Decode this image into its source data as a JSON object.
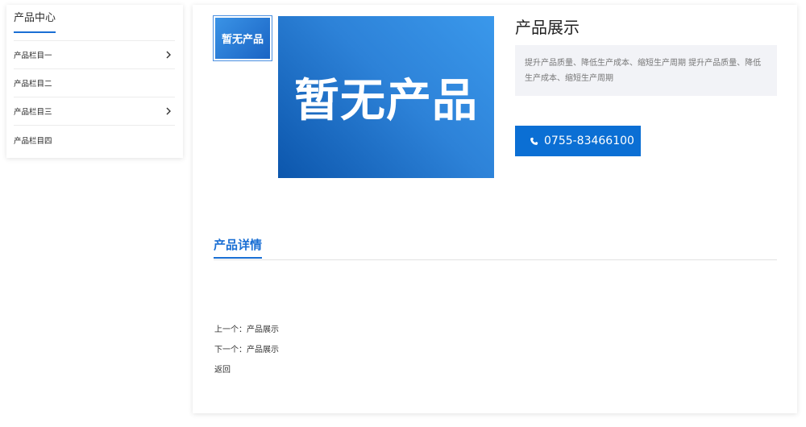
{
  "sidebar": {
    "title": "产品中心",
    "items": [
      {
        "label": "产品栏目一",
        "has_children": true
      },
      {
        "label": "产品栏目二",
        "has_children": false
      },
      {
        "label": "产品栏目三",
        "has_children": true
      },
      {
        "label": "产品栏目四",
        "has_children": false
      }
    ]
  },
  "product": {
    "thumb_text": "暂无产品",
    "image_text": "暂无产品",
    "title": "产品展示",
    "description": "提升产品质量、降低生产成本、缩短生产周期 提升产品质量、降低生产成本、缩短生产周期",
    "phone": "0755-83466100"
  },
  "detail": {
    "tab_label": "产品详情"
  },
  "pager": {
    "prev_prefix": "上一个：",
    "prev_title": "产品展示",
    "next_prefix": "下一个：",
    "next_title": "产品展示",
    "back_label": "返回"
  },
  "colors": {
    "accent": "#1a6fd4",
    "button": "#0b6fd4",
    "desc_bg": "#f2f3f7"
  },
  "icons": {
    "chevron": "chevron-right-icon",
    "phone": "phone-icon"
  }
}
